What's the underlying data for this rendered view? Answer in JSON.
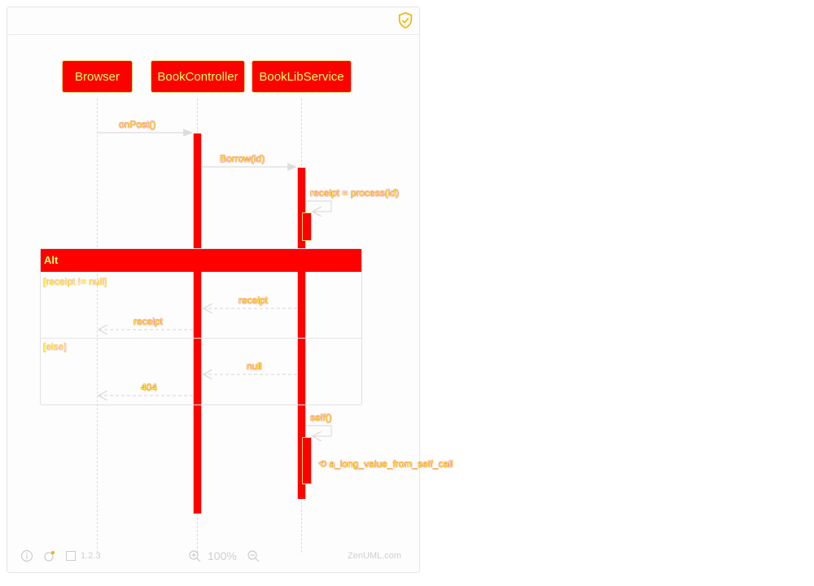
{
  "participants": [
    {
      "name": "Browser"
    },
    {
      "name": "BookController"
    },
    {
      "name": "BookLibService"
    }
  ],
  "messages": {
    "onpost": "onPost()",
    "borrow": "Borrow(id)",
    "receipt_assign": "receipt = process(id)",
    "receipt_return_service": "receipt",
    "receipt_return_controller": "receipt",
    "null_return": "null",
    "return_404": "404",
    "self_call": "self()",
    "self_return": "a_long_value_from_self_call"
  },
  "fragment": {
    "type": "Alt",
    "guard_if": "[receipt != null]",
    "guard_else": "[else]"
  },
  "footer": {
    "version": "1.2.3",
    "zoom": "100%",
    "brand": "ZenUML.com"
  }
}
